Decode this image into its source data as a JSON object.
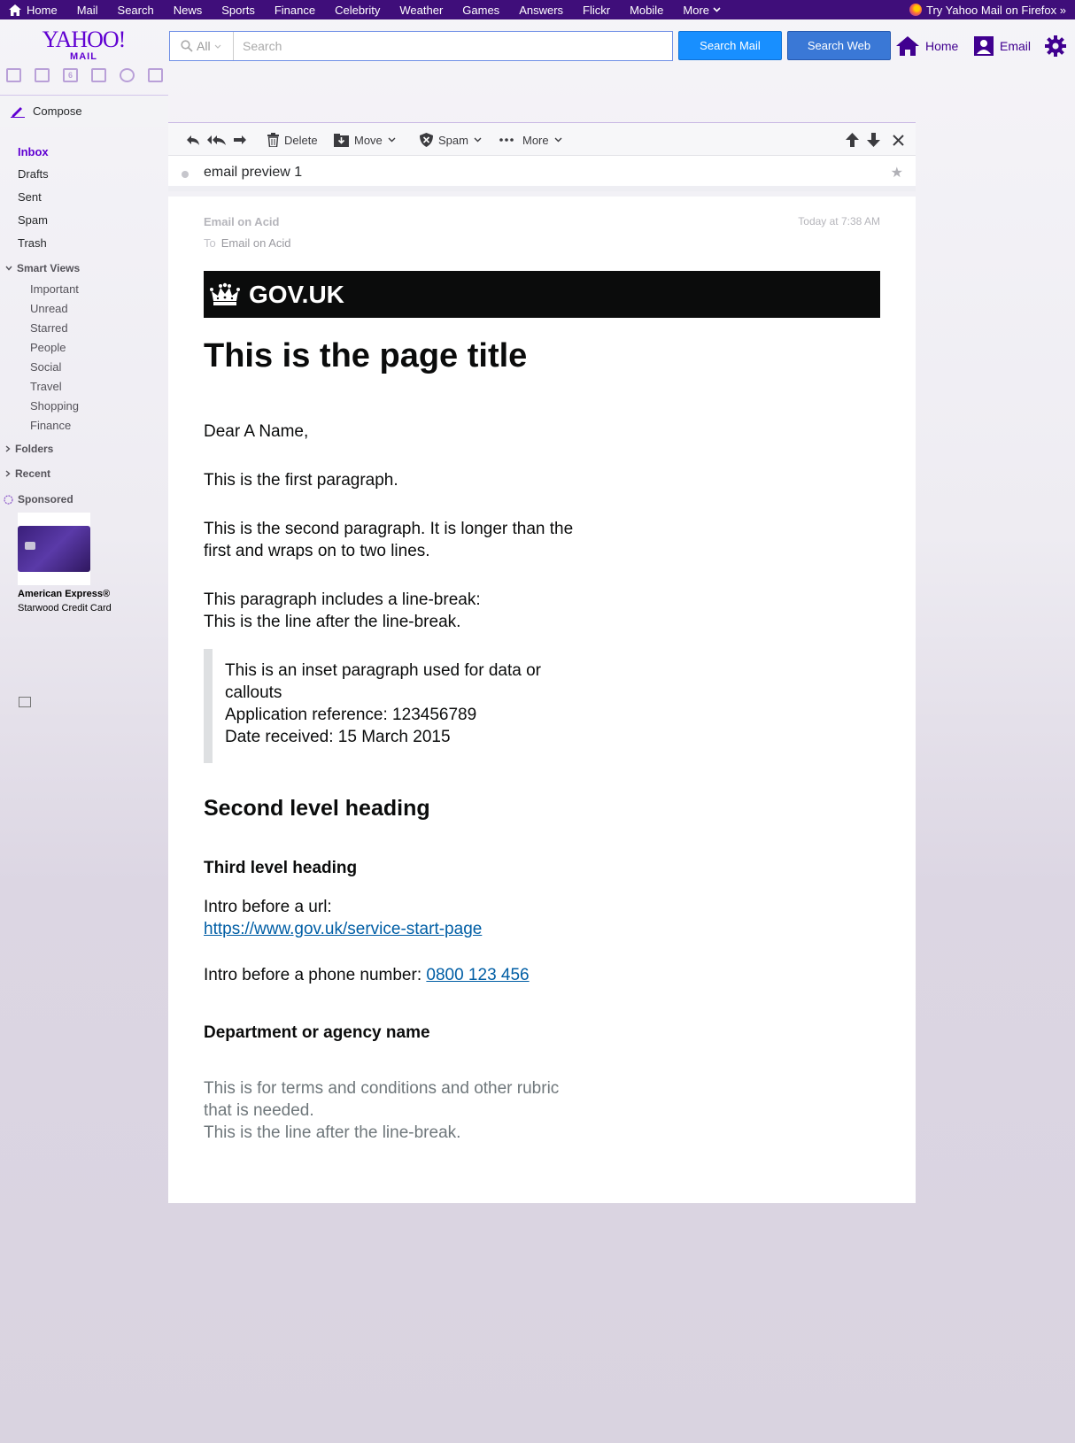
{
  "topnav": {
    "items": [
      "Home",
      "Mail",
      "Search",
      "News",
      "Sports",
      "Finance",
      "Celebrity",
      "Weather",
      "Games",
      "Answers",
      "Flickr",
      "Mobile",
      "More"
    ],
    "firefox_promo": "Try Yahoo Mail on Firefox »"
  },
  "header": {
    "logo_text": "YAHOO!",
    "logo_sub": "MAIL",
    "search_scope": "All",
    "search_placeholder": "Search",
    "search_mail_label": "Search Mail",
    "search_web_label": "Search Web",
    "home_label": "Home",
    "email_label": "Email"
  },
  "quick_icons": [
    "mail-icon",
    "contacts-icon",
    "calendar-icon",
    "notepad-icon",
    "messenger-icon",
    "newsfeed-icon"
  ],
  "calendar_day": "6",
  "sidebar": {
    "compose_label": "Compose",
    "folders": [
      "Inbox",
      "Drafts",
      "Sent",
      "Spam",
      "Trash"
    ],
    "smart_views_label": "Smart Views",
    "smart_views": [
      "Important",
      "Unread",
      "Starred",
      "People",
      "Social",
      "Travel",
      "Shopping",
      "Finance"
    ],
    "folders_label": "Folders",
    "recent_label": "Recent",
    "sponsored_label": "Sponsored",
    "ad_title": "American Express®",
    "ad_subtitle": "Starwood Credit Card"
  },
  "toolbar": {
    "delete_label": "Delete",
    "move_label": "Move",
    "spam_label": "Spam",
    "more_label": "More"
  },
  "message": {
    "subject": "email preview 1",
    "from": "Email on Acid",
    "to_label": "To",
    "to": "Email on Acid",
    "date": "Today at 7:38 AM",
    "gov_brand": "GOV.UK",
    "page_title": "This is the page title",
    "greeting": "Dear A Name,",
    "para1": "This is the first paragraph.",
    "para2_line1": "This is the second paragraph. It is longer than the",
    "para2_line2": "first and wraps on to two lines.",
    "para3_line1": "This paragraph includes a line-break:",
    "para3_line2": "This is the line after the line-break.",
    "inset_line1": "This is an inset paragraph used for data or",
    "inset_line2": "callouts",
    "inset_line3": "Application reference: 123456789",
    "inset_line4": "Date received: 15 March 2015",
    "heading2": "Second level heading",
    "heading3": "Third level heading",
    "url_intro": "Intro before a url:",
    "url": "https://www.gov.uk/service-start-page",
    "phone_intro": "Intro before a phone number:",
    "phone": "0800 123 456",
    "dept": "Department or agency name",
    "rubric_line1": "This is for terms and conditions and other rubric",
    "rubric_line2": "that is needed.",
    "rubric_line3": "This is the line after the line-break."
  },
  "colors": {
    "yahoo_purple": "#400090",
    "brand_purple": "#6001d2",
    "search_mail_blue": "#188fff",
    "gov_black": "#0b0c0c",
    "gov_link": "#005ea5"
  }
}
